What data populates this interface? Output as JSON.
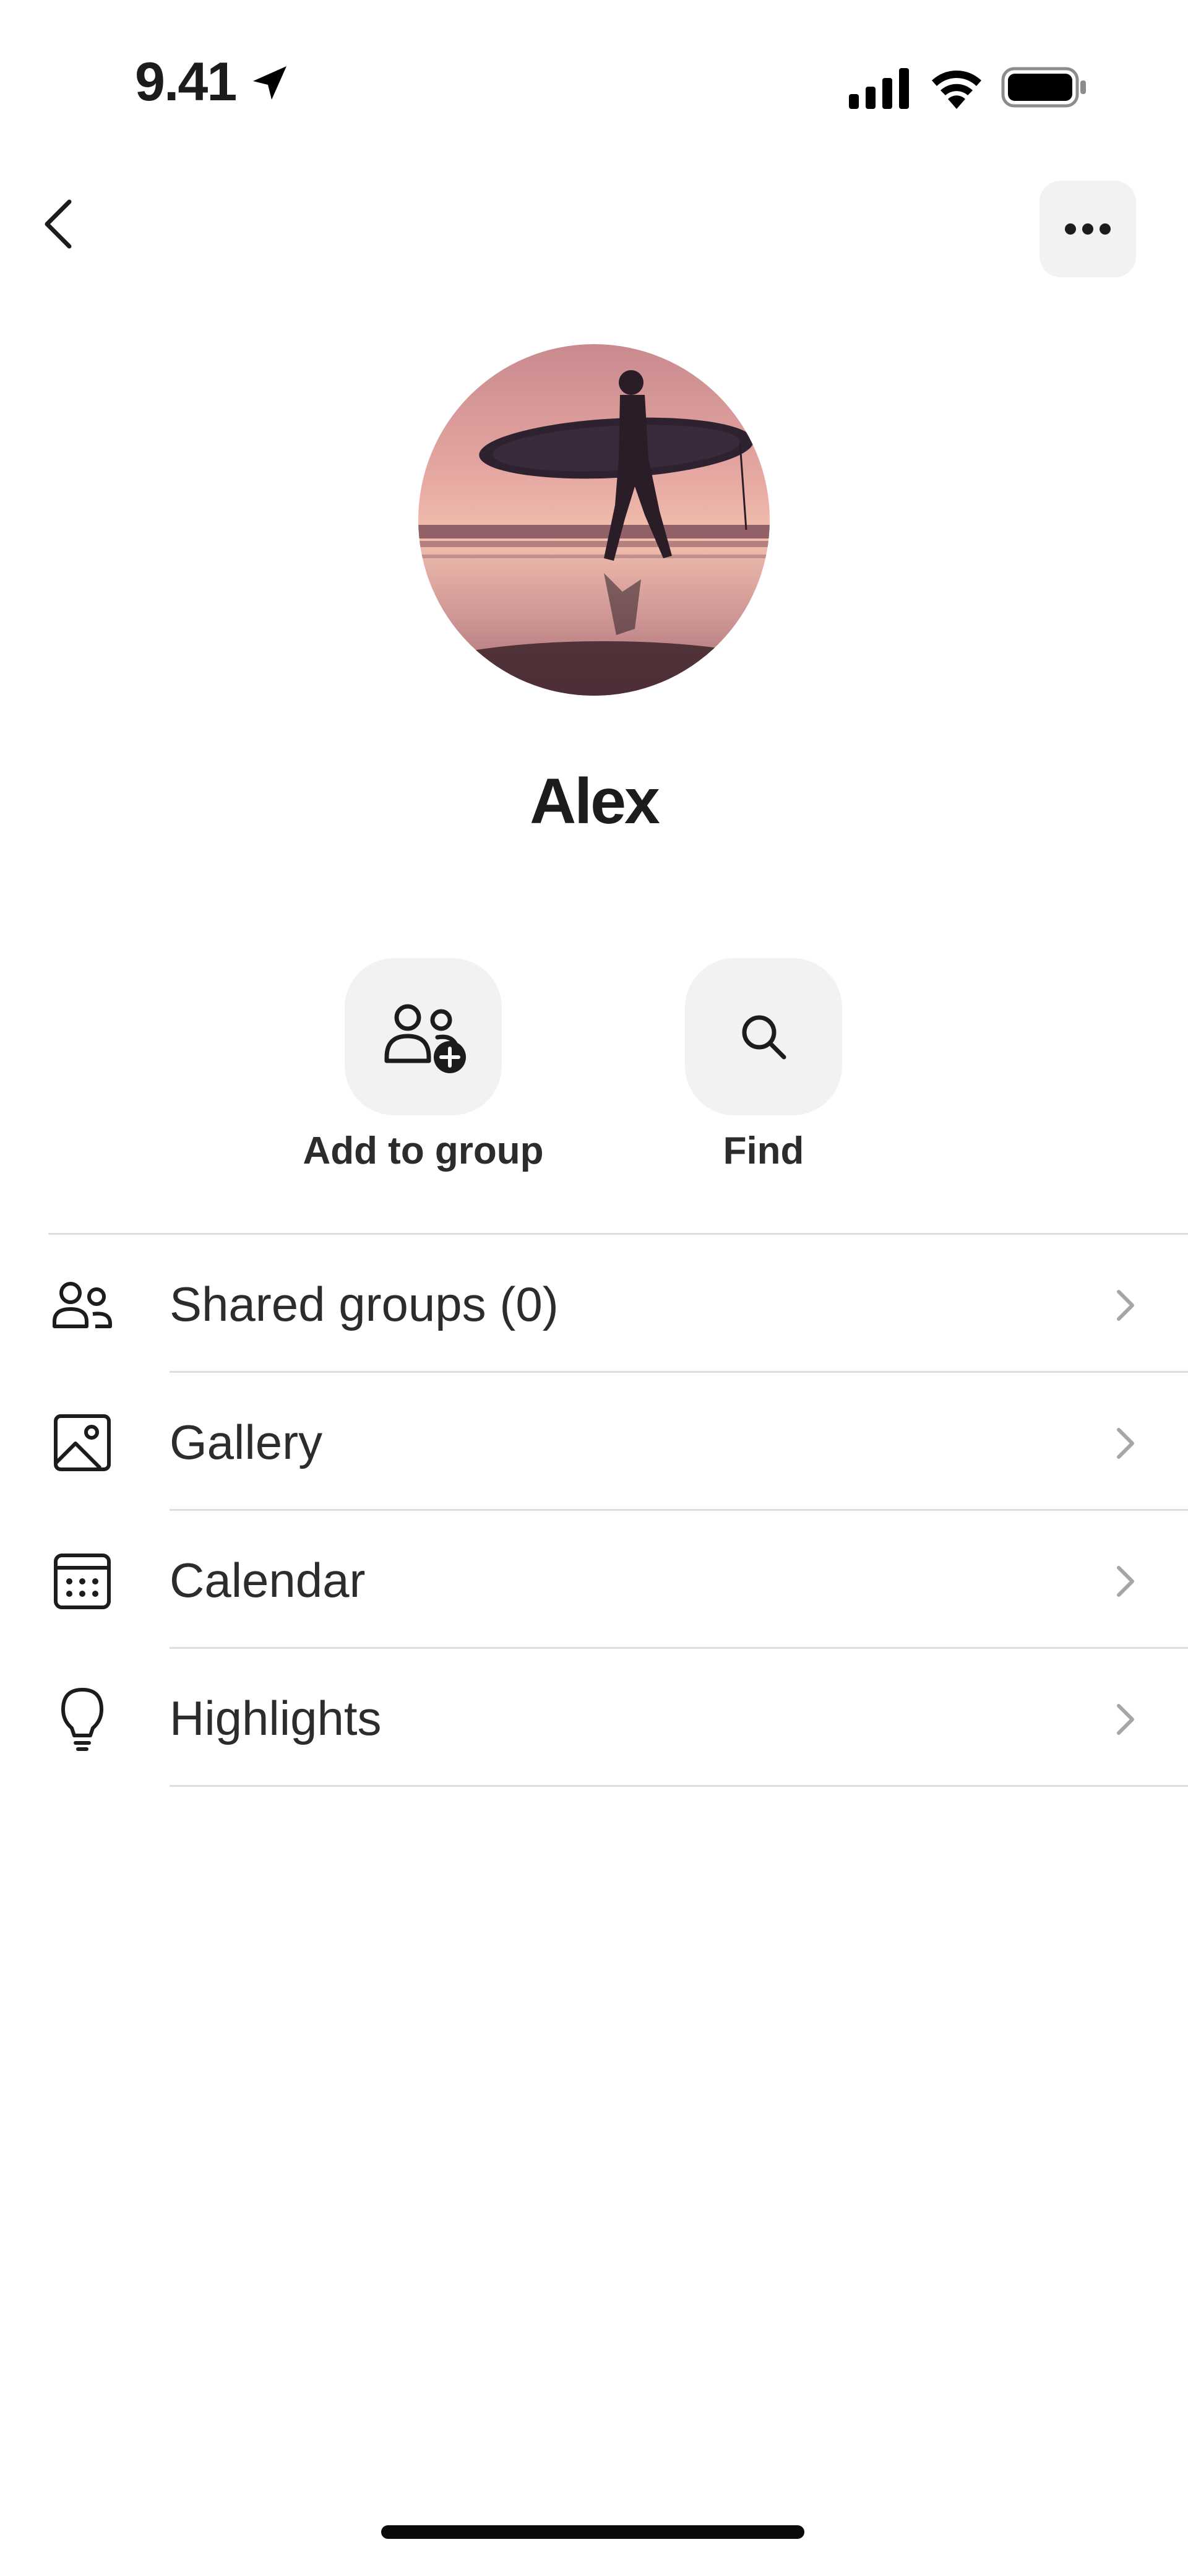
{
  "status_bar": {
    "time": "9.41"
  },
  "profile": {
    "name": "Alex",
    "avatar_icon": "surfer-silhouette-avatar"
  },
  "actions": [
    {
      "label": "Add to group",
      "icon": "add-user-group-icon"
    },
    {
      "label": "Find",
      "icon": "search-icon"
    }
  ],
  "menu": [
    {
      "label": "Shared groups (0)",
      "icon": "groups-icon"
    },
    {
      "label": "Gallery",
      "icon": "image-icon"
    },
    {
      "label": "Calendar",
      "icon": "calendar-icon"
    },
    {
      "label": "Highlights",
      "icon": "lightbulb-icon"
    }
  ],
  "colors": {
    "background": "#ffffff",
    "button_bg": "#f2f2f2",
    "divider": "#dedede",
    "text": "#1c1c1e",
    "chevron": "#a6a6a6"
  }
}
